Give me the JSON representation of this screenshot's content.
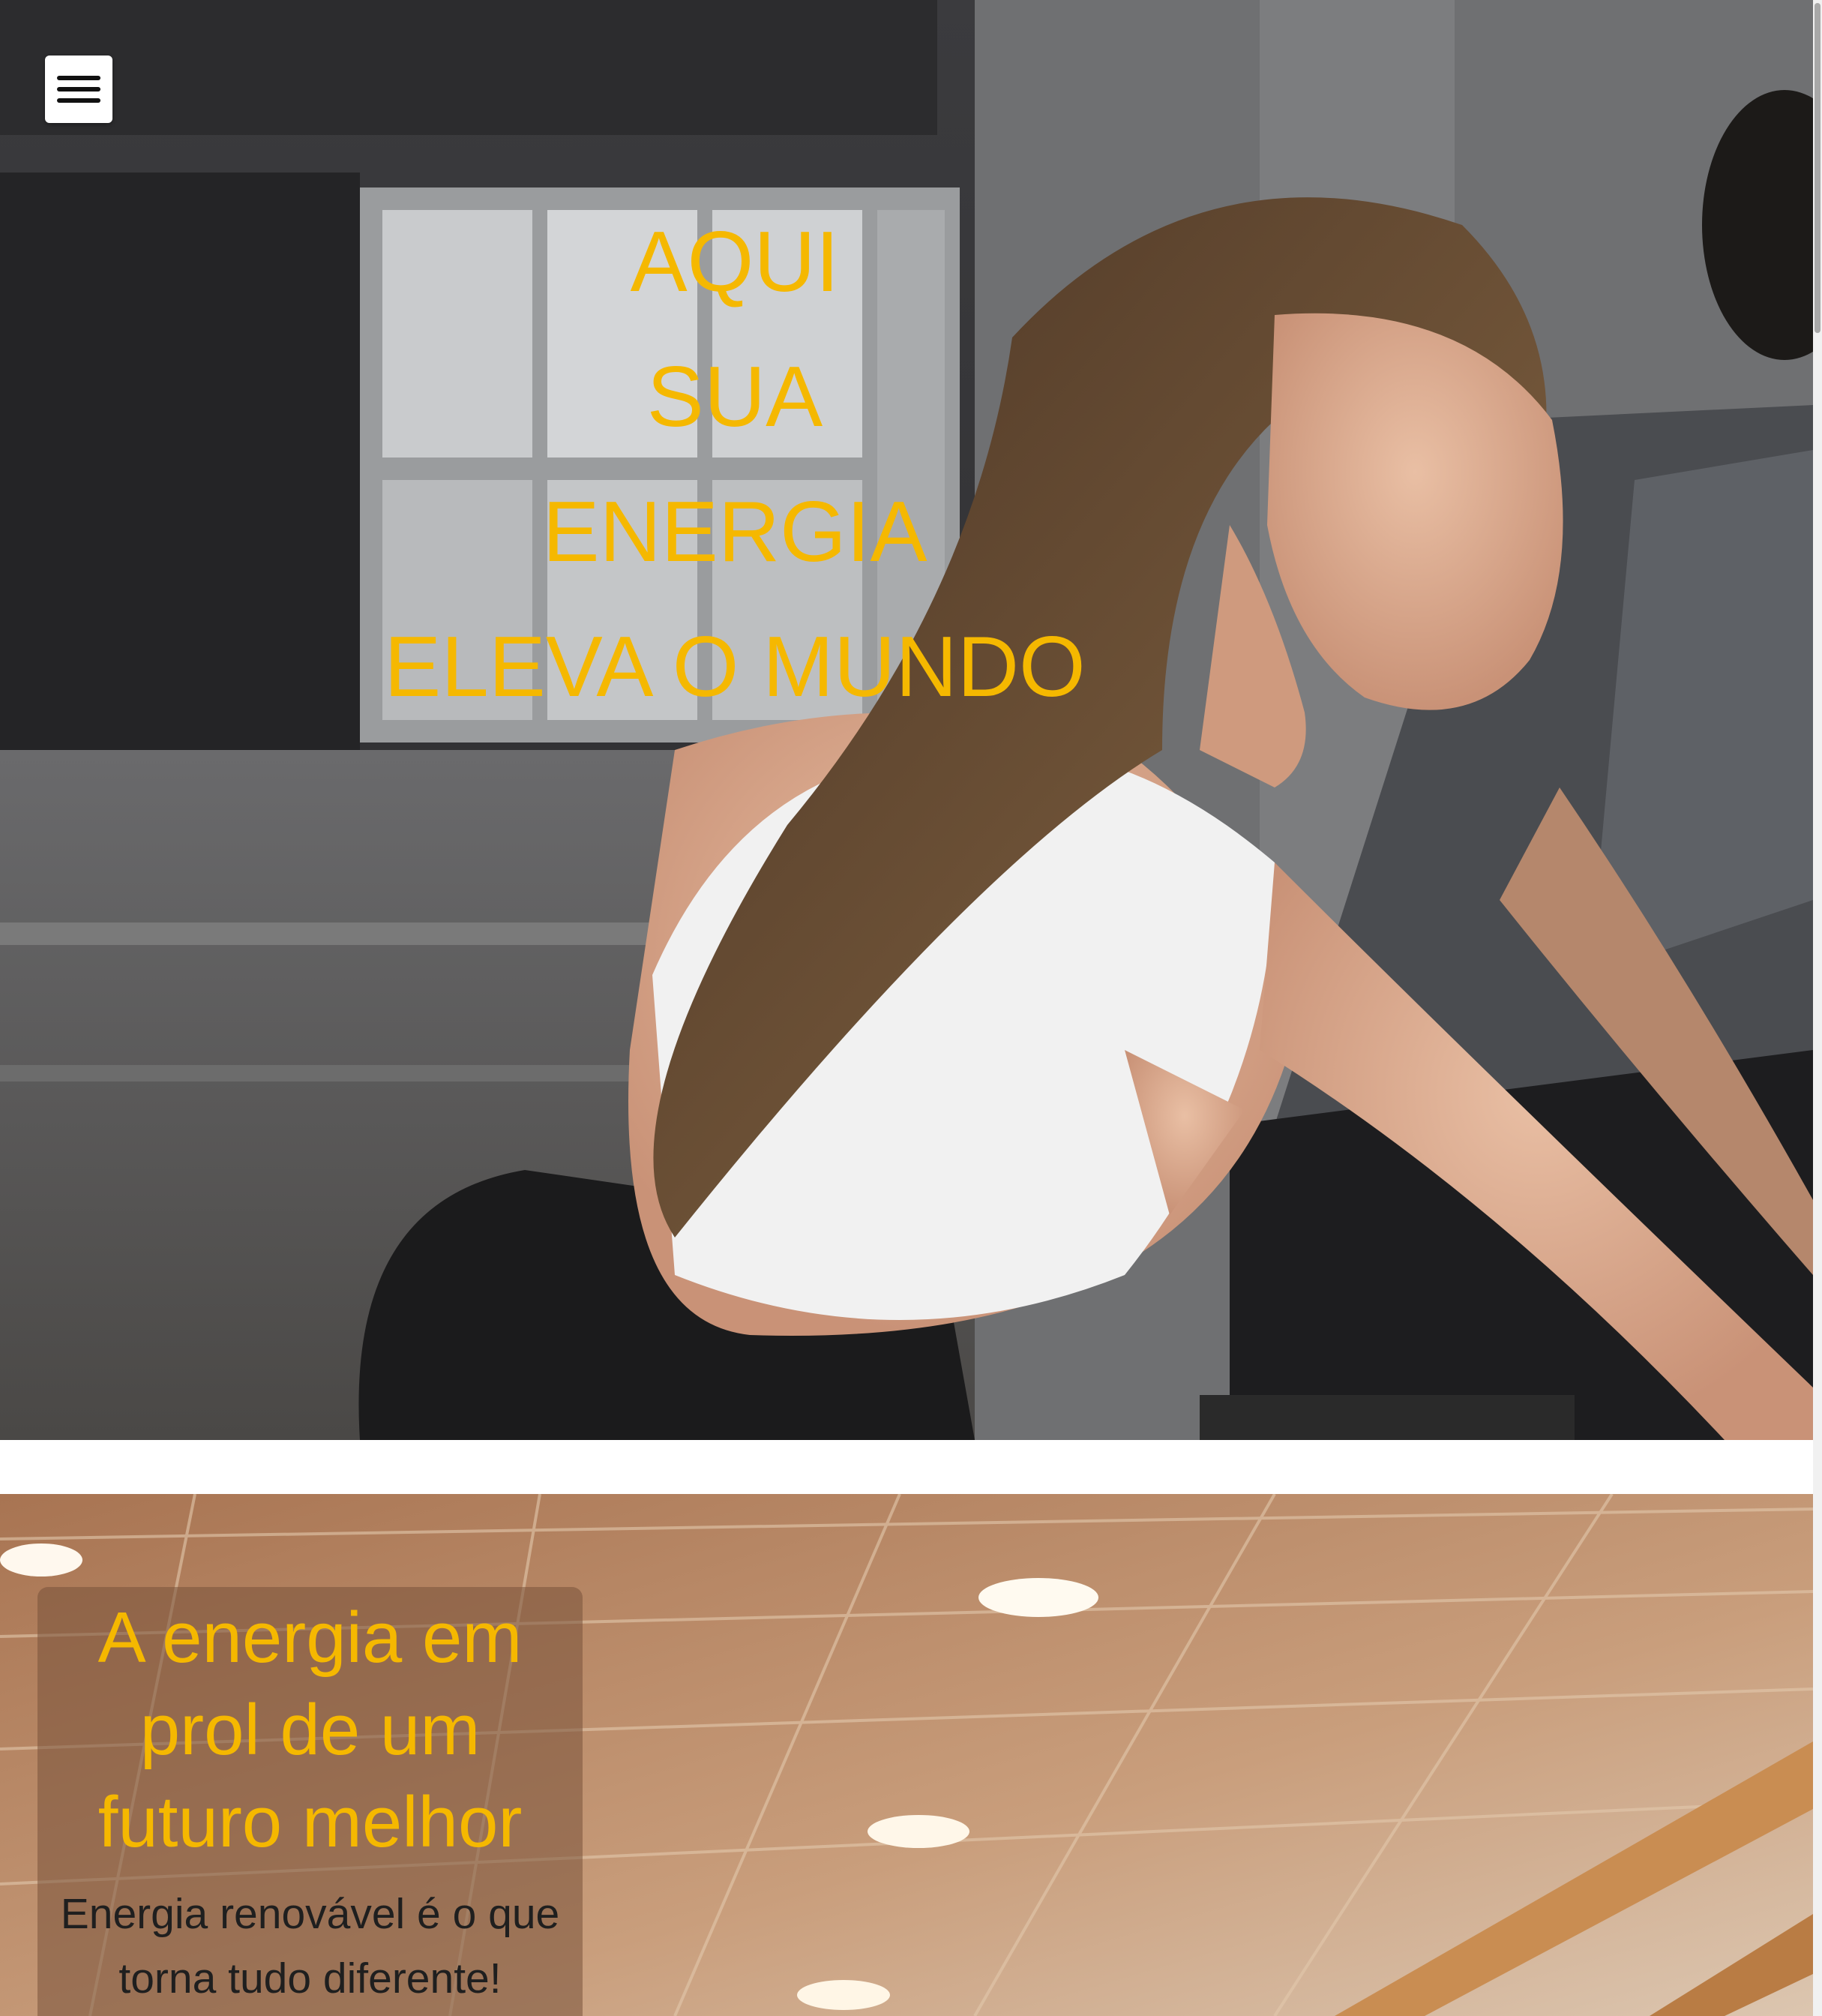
{
  "hero": {
    "menu_icon": "hamburger-menu-icon",
    "heading_lines": [
      "AQUI",
      "SUA",
      "ENERGIA",
      "ELEVA O MUNDO"
    ],
    "background": "photo of woman on exercise bike in gym",
    "accent_color": "#f5b800"
  },
  "about": {
    "title": "A energia em prol de um futuro melhor",
    "text": "Energia renovável é o que torna tudo diferente!",
    "background": "gym ceiling with lights",
    "title_color": "#f5b800"
  }
}
